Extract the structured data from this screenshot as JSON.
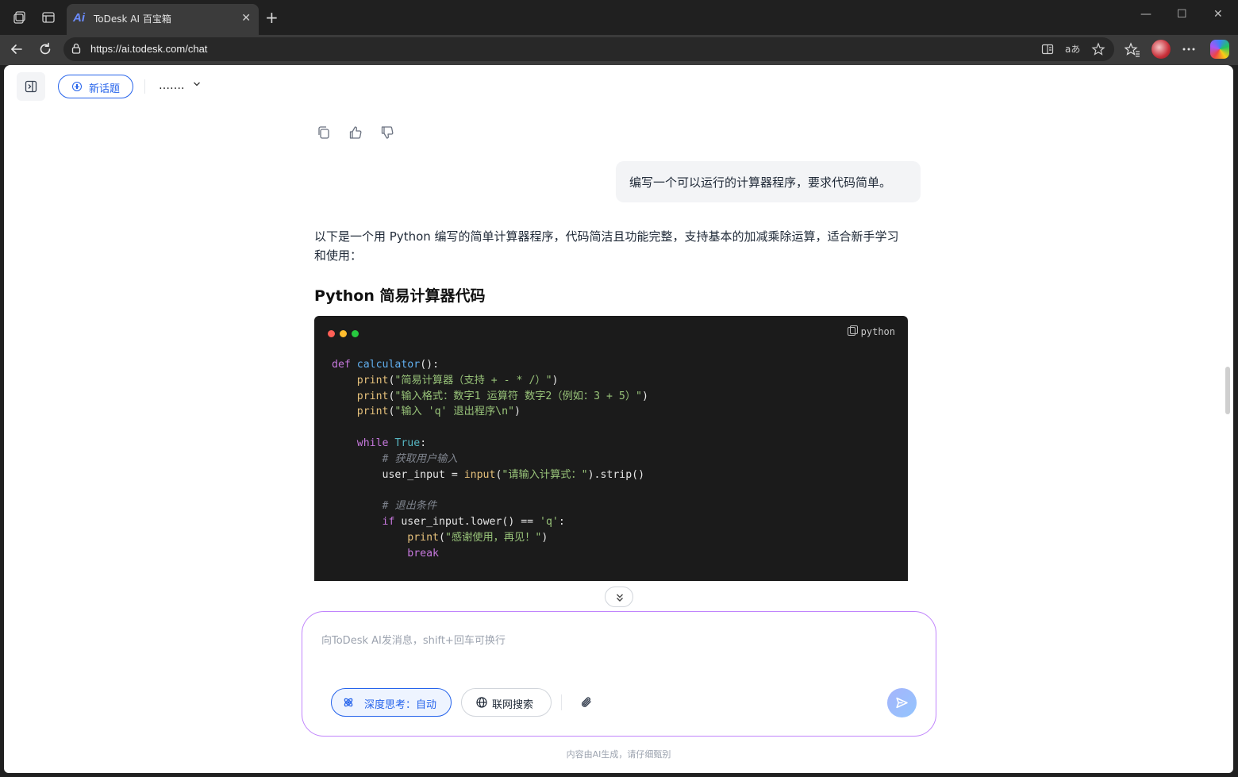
{
  "browser": {
    "tab_title": "ToDesk AI 百宝箱",
    "tab_logo": "Ai",
    "url": "https://ai.todesk.com/chat",
    "new_tab_symbol": "+",
    "close_tab_symbol": "✕",
    "window_controls": [
      "—",
      "☐",
      "✕"
    ],
    "icons": [
      "workspaces-icon",
      "tab-actions-icon",
      "back-icon",
      "refresh-icon",
      "lock-icon",
      "split-screen-icon",
      "read-aloud-icon",
      "favorite-star-icon",
      "favorites-icon",
      "profile-avatar",
      "more-icon",
      "copilot-icon"
    ]
  },
  "header": {
    "new_topic_label": "新话题",
    "model_label": "……."
  },
  "chat": {
    "user_message": "编写一个可以运行的计算器程序，要求代码简单。",
    "answer_intro": "以下是一个用 Python 编写的简单计算器程序，代码简洁且功能完整，支持基本的加减乘除运算，适合新手学习和使用：",
    "answer_heading": "Python 简易计算器代码",
    "code_language": "python",
    "code_dots": [
      "#ff5f56",
      "#ffbd2e",
      "#27c93f"
    ]
  },
  "composer": {
    "placeholder": "向ToDesk AI发消息，shift+回车可换行",
    "deep_think_label": "深度思考：自动",
    "web_search_label": "联网搜索"
  },
  "footer": {
    "disclaimer": "内容由AI生成，请仔细甄别"
  },
  "colors": {
    "accent": "#2563eb",
    "composer_border": "#c084fc",
    "code_bg": "#1b1b1b"
  }
}
